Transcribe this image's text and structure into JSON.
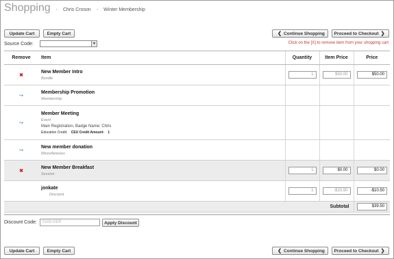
{
  "header": {
    "title": "Shopping",
    "member_name": "Chris Croson",
    "separator": "-",
    "membership": "Winter Membership"
  },
  "toolbar": {
    "update_cart": "Update Cart",
    "empty_cart": "Empty Cart",
    "continue_shopping": "Continue Shopping",
    "proceed_checkout": "Proceed to Checkout"
  },
  "source_code": {
    "label": "Source Code:",
    "value": ""
  },
  "hint": "Click on the [X] to remove item from your shopping cart",
  "table": {
    "headers": {
      "remove": "Remove",
      "item": "Item",
      "quantity": "Quantity",
      "item_price": "Item Price",
      "price": "Price"
    },
    "rows": [
      {
        "icon": "remove-x-icon",
        "name": "New Member Intro",
        "type": "Bundle",
        "qty": "1",
        "item_price": "$50.00",
        "price": "$50.00"
      },
      {
        "icon": "swap-arrow-icon",
        "name": "Membership Promotion",
        "type": "Membership"
      },
      {
        "icon": "swap-arrow-icon",
        "name": "Member Meeting",
        "type": "Event",
        "detail": "Main Registration, Badge Name: Chris",
        "credit_label": "Education Credit:",
        "credit_name": "CEU Credit Amount:",
        "credit_value": "1"
      },
      {
        "icon": "swap-arrow-icon",
        "name": "New member donation",
        "type": "Miscellaneous"
      },
      {
        "icon": "remove-x-icon",
        "name": "New Member Breakfast",
        "type": "Session",
        "qty": "1",
        "item_price": "$0.00",
        "price": "$0.00"
      },
      {
        "name": "jonkate",
        "type": "Discount",
        "qty": "1",
        "item_price": "-$10.50",
        "price": "-$10.50"
      }
    ],
    "subtotal_label": "Subtotal",
    "subtotal_value": "$39.50"
  },
  "discount": {
    "label": "Discount Code:",
    "value": "0102-010f",
    "apply": "Apply Discount"
  },
  "colors": {
    "remove": "#d02020",
    "arrow": "#3b7fc4",
    "hint": "#c0392b"
  }
}
